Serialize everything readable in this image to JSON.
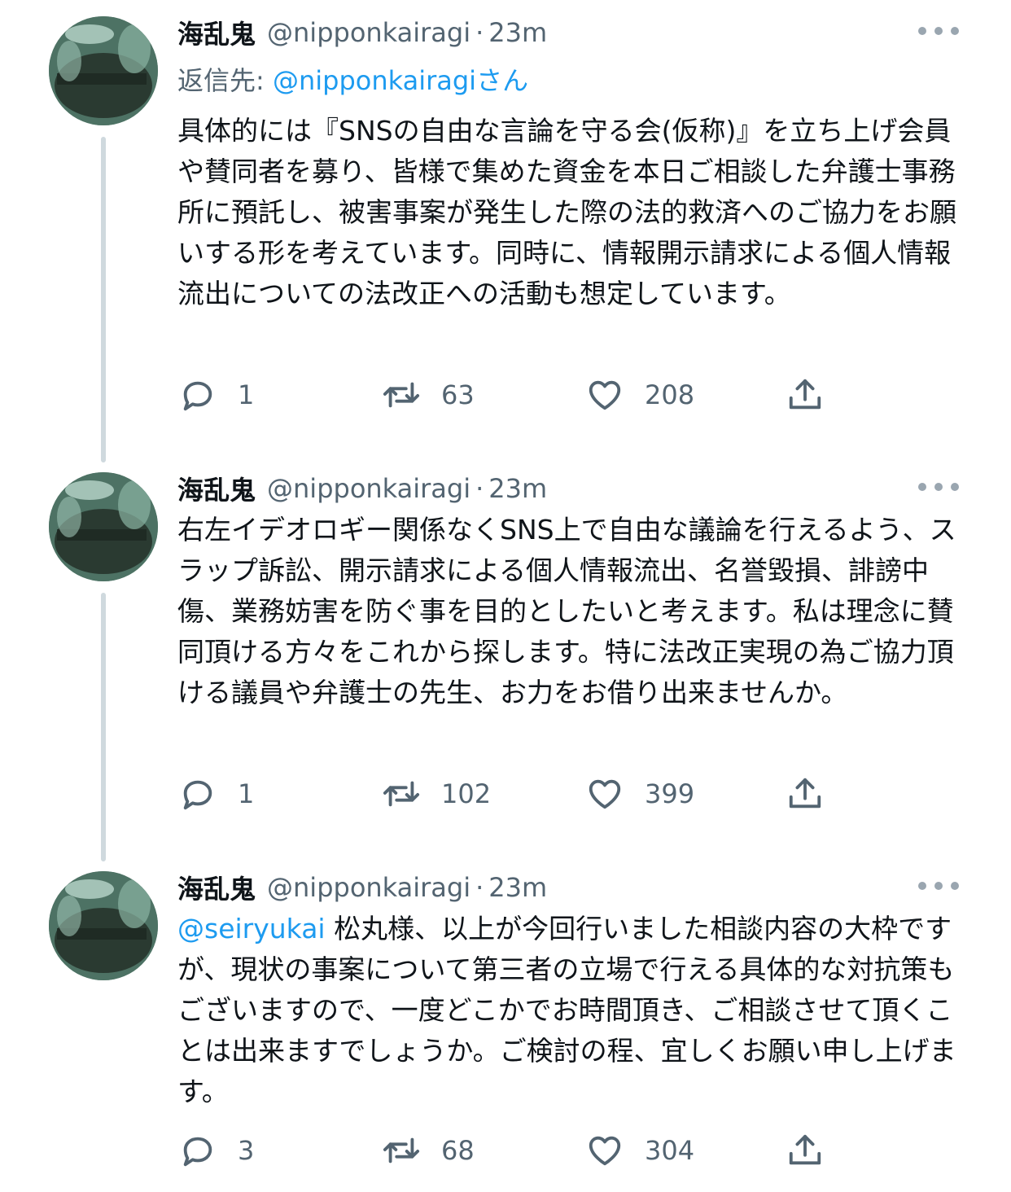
{
  "tweets": [
    {
      "display_name": "海乱鬼",
      "handle": "@nipponkairagi",
      "separator": "·",
      "time": "23m",
      "reply_label": "返信先: ",
      "reply_mention": "@nipponkairagi",
      "reply_suffix": "さん",
      "text": "具体的には『SNSの自由な言論を守る会(仮称)』を立ち上げ会員や賛同者を募り、皆様で集めた資金を本日ご相談した弁護士事務所に預託し、被害事案が発生した際の法的救済へのご協力をお願いする形を考えています。同時に、情報開示請求による個人情報流出についての法改正への活動も想定しています。",
      "replies": "1",
      "retweets": "63",
      "likes": "208"
    },
    {
      "display_name": "海乱鬼",
      "handle": "@nipponkairagi",
      "separator": "·",
      "time": "23m",
      "text": "右左イデオロギー関係なくSNS上で自由な議論を行えるよう、スラップ訴訟、開示請求による個人情報流出、名誉毀損、誹謗中傷、業務妨害を防ぐ事を目的としたいと考えます。私は理念に賛同頂ける方々をこれから探します。特に法改正実現の為ご協力頂ける議員や弁護士の先生、お力をお借り出来ませんか。",
      "replies": "1",
      "retweets": "102",
      "likes": "399"
    },
    {
      "display_name": "海乱鬼",
      "handle": "@nipponkairagi",
      "separator": "·",
      "time": "23m",
      "mention": "@seiryukai",
      "text": " 松丸様、以上が今回行いました相談内容の大枠ですが、現状の事案について第三者の立場で行える具体的な対抗策もございますので、一度どこかでお時間頂き、ご相談させて頂くことは出来ますでしょうか。ご検討の程、宜しくお願い申し上げます。",
      "replies": "3",
      "retweets": "68",
      "likes": "304"
    }
  ],
  "icons": {
    "reply": "reply-icon",
    "retweet": "retweet-icon",
    "like": "heart-icon",
    "share": "share-icon",
    "more": "more-icon"
  },
  "colors": {
    "link": "#1d9bf0",
    "secondary": "#536471",
    "thread_line": "#cfd9de"
  }
}
